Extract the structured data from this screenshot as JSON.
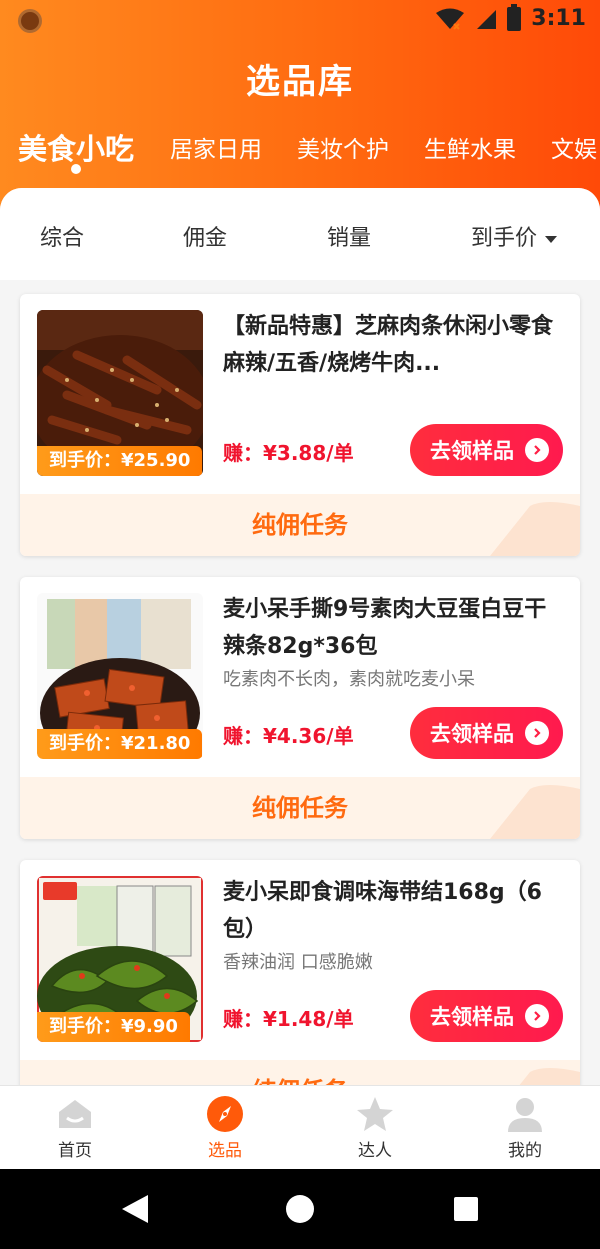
{
  "status_bar": {
    "time": "3:11"
  },
  "header": {
    "title": "选品库"
  },
  "category_tabs": [
    {
      "label": "美食小吃",
      "active": true
    },
    {
      "label": "居家日用",
      "active": false
    },
    {
      "label": "美妆个护",
      "active": false
    },
    {
      "label": "生鲜水果",
      "active": false
    },
    {
      "label": "文娱",
      "active": false
    }
  ],
  "sort_bar": {
    "items": [
      "综合",
      "佣金",
      "销量",
      "到手价"
    ]
  },
  "products": [
    {
      "title": "【新品特惠】芝麻肉条休闲小零食 麻辣/五香/烧烤牛肉...",
      "subtitle": "",
      "price_tag": "到手价：¥25.90",
      "earn": "赚：¥3.88/单",
      "button": "去领样品",
      "task": "纯佣任务",
      "thumb_icon": "spicy-meat-strips-photo"
    },
    {
      "title": "麦小呆手撕9号素肉大豆蛋白豆干辣条82g*36包",
      "subtitle": "吃素肉不长肉，素肉就吃麦小呆",
      "price_tag": "到手价：¥21.80",
      "earn": "赚：¥4.36/单",
      "button": "去领样品",
      "task": "纯佣任务",
      "thumb_icon": "vegetarian-meat-snack-photo"
    },
    {
      "title": "麦小呆即食调味海带结168g（6包）",
      "subtitle": "香辣油润 口感脆嫩",
      "price_tag": "到手价：¥9.90",
      "earn": "赚：¥1.48/单",
      "button": "去领样品",
      "task": "纯佣任务",
      "thumb_icon": "seaweed-knot-snack-photo"
    }
  ],
  "bottom_nav": [
    {
      "label": "首页",
      "icon": "home-icon",
      "active": false
    },
    {
      "label": "选品",
      "icon": "compass-icon",
      "active": true
    },
    {
      "label": "达人",
      "icon": "star-person-icon",
      "active": false
    },
    {
      "label": "我的",
      "icon": "user-icon",
      "active": false
    }
  ],
  "colors": {
    "accent": "#ff5a0a",
    "earn": "#f0142e",
    "button": "#ff1f45"
  }
}
